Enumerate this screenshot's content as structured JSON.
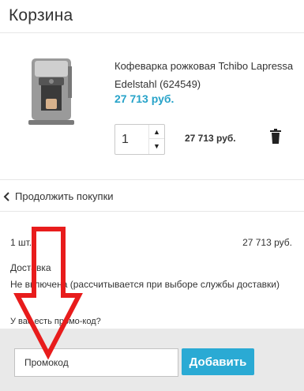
{
  "header": {
    "title": "Корзина"
  },
  "cart_item": {
    "name": "Кофеварка рожковая Tchibo Lapressa Edelstahl (624549)",
    "price": "27 713 руб.",
    "quantity": "1",
    "line_total": "27 713 руб.",
    "icons": {
      "quantity_up": "chevron-up-icon",
      "quantity_down": "chevron-down-icon",
      "remove": "trash-icon"
    }
  },
  "continue_link": {
    "label": "Продолжить покупки",
    "icon": "chevron-left-icon"
  },
  "summary": {
    "items_count": "1 шт.",
    "total": "27 713 руб.",
    "delivery_title": "Доставка",
    "delivery_note": "Не включена (рассчитывается при выборе службы доставки)"
  },
  "promo": {
    "question": "У вас есть промо-код?",
    "placeholder": "Промокод",
    "button_label": "Добавить"
  },
  "colors": {
    "accent": "#2aaad4",
    "price": "#27a3c9",
    "annotation": "#e81c1c",
    "panel_bg": "#e9e9e9"
  }
}
